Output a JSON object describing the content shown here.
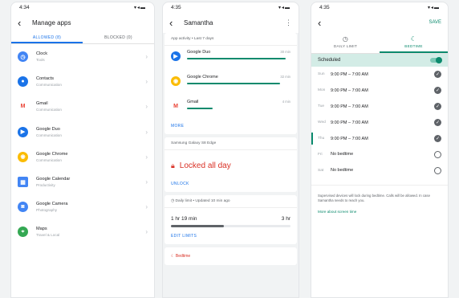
{
  "screen1": {
    "status_time": "4:34",
    "title": "Manage apps",
    "tabs": [
      "ALLOWED (8)",
      "BLOCKED (0)"
    ],
    "apps": [
      {
        "name": "Clock",
        "category": "Tools",
        "icon": "clock-icon",
        "color": "#4285f4"
      },
      {
        "name": "Contacts",
        "category": "Communication",
        "icon": "contacts-icon",
        "color": "#1a73e8"
      },
      {
        "name": "Gmail",
        "category": "Communication",
        "icon": "gmail-icon",
        "color": "#ea4335"
      },
      {
        "name": "Google Duo",
        "category": "Communication",
        "icon": "duo-icon",
        "color": "#1a73e8"
      },
      {
        "name": "Google Chrome",
        "category": "Communication",
        "icon": "chrome-icon",
        "color": "#fbbc04"
      },
      {
        "name": "Google Calendar",
        "category": "Productivity",
        "icon": "calendar-icon",
        "color": "#4285f4"
      },
      {
        "name": "Google Camera",
        "category": "Photography",
        "icon": "camera-icon",
        "color": "#4285f4"
      },
      {
        "name": "Maps",
        "category": "Travel & Local",
        "icon": "maps-icon",
        "color": "#34a853"
      }
    ]
  },
  "screen2": {
    "status_time": "4:35",
    "title": "Samantha",
    "activity_header": "App activity • Last 7 days",
    "usage": [
      {
        "name": "Google Duo",
        "time": "30 min",
        "icon": "duo-icon",
        "color": "#1a73e8",
        "fraction": 0.95
      },
      {
        "name": "Google Chrome",
        "time": "32 min",
        "icon": "chrome-icon",
        "color": "#fbbc04",
        "fraction": 0.9
      },
      {
        "name": "Gmail",
        "time": "4 min",
        "icon": "gmail-icon",
        "color": "#ea4335",
        "fraction": 0.25
      }
    ],
    "more_label": "MORE",
    "device": "Samsung Galaxy S8 Edge",
    "locked_text": "Locked all day",
    "unlock_label": "UNLOCK",
    "daily_limit_header": "Daily limit • Updated 10 min ago",
    "used_time": "1 hr 19 min",
    "limit_time": "3 hr",
    "limit_fraction": 0.44,
    "edit_limits_label": "EDIT LIMITS",
    "bedtime_label": "Bedtime"
  },
  "screen3": {
    "status_time": "4:35",
    "save_label": "SAVE",
    "tabs": [
      "DAILY LIMIT",
      "BEDTIME"
    ],
    "scheduled_label": "Scheduled",
    "days": [
      {
        "day": "Sun",
        "time": "9:00 PM – 7:00 AM",
        "checked": true
      },
      {
        "day": "Mon",
        "time": "9:00 PM – 7:00 AM",
        "checked": true
      },
      {
        "day": "Tue",
        "time": "9:00 PM – 7:00 AM",
        "checked": true
      },
      {
        "day": "Wed",
        "time": "9:00 PM – 7:00 AM",
        "checked": true
      },
      {
        "day": "Thu",
        "time": "9:00 PM – 7:00 AM",
        "checked": true
      },
      {
        "day": "Fri",
        "time": "No bedtime",
        "checked": false
      },
      {
        "day": "Sat",
        "time": "No bedtime",
        "checked": false
      }
    ],
    "note": "Supervised devices will lock during bedtime. Calls will be allowed. In case Samantha needs to reach you.",
    "more_link": "More about screen time"
  },
  "colors": {
    "accent_blue": "#1a73e8",
    "accent_green": "#0b8a6d",
    "locked_red": "#d93025"
  }
}
